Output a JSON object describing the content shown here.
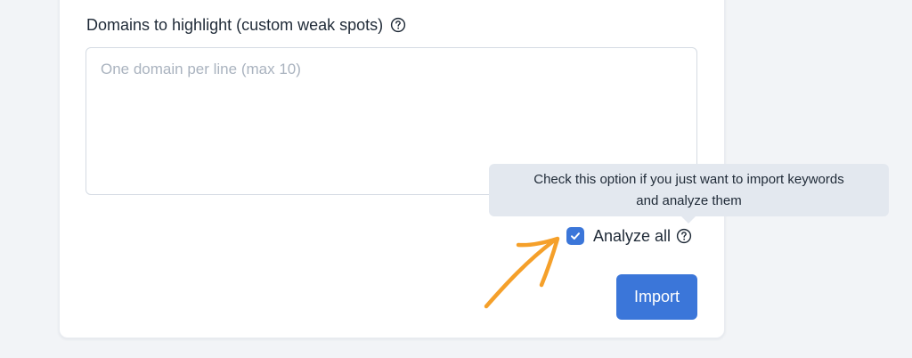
{
  "form": {
    "domains_label": "Domains to highlight (custom weak spots)",
    "domains_help_icon": "question-circle-icon",
    "domains_placeholder": "One domain per line (max 10)",
    "domains_value": ""
  },
  "tooltip": {
    "line1": "Check this option if you just want to import keywords",
    "line2": "and analyze them"
  },
  "analyze_all": {
    "label": "Analyze all",
    "checked": true,
    "help_icon": "question-circle-icon"
  },
  "import_button": {
    "label": "Import"
  },
  "annotation": {
    "icon": "hand-drawn-arrow-icon",
    "color": "#f5a02a"
  },
  "colors": {
    "accent": "#3b76d9",
    "text": "#1f2a37",
    "placeholder": "#aab3bf",
    "tooltip_bg": "#e3e8ef",
    "page_bg": "#f2f4f7"
  }
}
